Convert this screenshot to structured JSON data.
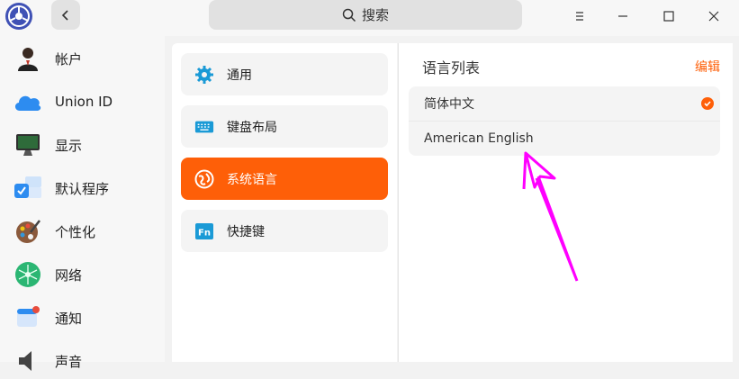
{
  "titlebar": {
    "search_placeholder": "搜索",
    "icons": [
      "app-logo-icon",
      "chevron-left-icon",
      "search-icon",
      "menu-icon",
      "minimize-icon",
      "maximize-icon",
      "close-icon"
    ]
  },
  "sidebar": {
    "items": [
      {
        "label": "帐户",
        "icon": "account-icon"
      },
      {
        "label": "Union ID",
        "icon": "cloud-icon"
      },
      {
        "label": "显示",
        "icon": "display-icon"
      },
      {
        "label": "默认程序",
        "icon": "default-apps-icon"
      },
      {
        "label": "个性化",
        "icon": "personalization-icon"
      },
      {
        "label": "网络",
        "icon": "network-icon"
      },
      {
        "label": "通知",
        "icon": "notification-icon"
      },
      {
        "label": "声音",
        "icon": "sound-icon"
      }
    ]
  },
  "middle": {
    "items": [
      {
        "label": "通用",
        "icon": "gear-icon"
      },
      {
        "label": "键盘布局",
        "icon": "keyboard-icon"
      },
      {
        "label": "系统语言",
        "icon": "language-icon",
        "active": true
      },
      {
        "label": "快捷键",
        "icon": "fn-key-icon"
      }
    ]
  },
  "right": {
    "title": "语言列表",
    "edit_label": "编辑",
    "languages": [
      {
        "label": "简体中文",
        "selected": true
      },
      {
        "label": "American English",
        "selected": false
      }
    ]
  },
  "colors": {
    "accent": "#fe5f08",
    "annotation": "#ff00ff"
  }
}
